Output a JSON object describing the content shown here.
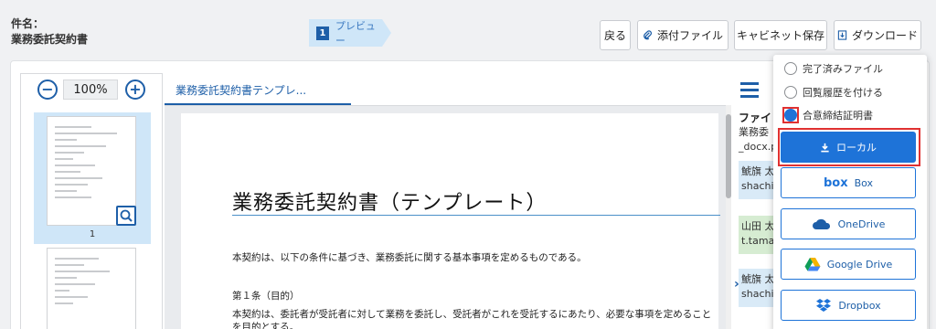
{
  "header": {
    "subject_label": "件名：",
    "subject_value": "業務委託契約書",
    "step_number": "1",
    "step_label": "プレビュー",
    "buttons": {
      "back": "戻る",
      "attach": "添付ファイル",
      "cabinet": "キャビネット保存",
      "download": "ダウンロード"
    }
  },
  "thumbnails": {
    "zoom_value": "100%",
    "zoom_out_icon": "minus-circle-icon",
    "zoom_in_icon": "plus-circle-icon",
    "page_number": "1"
  },
  "document": {
    "tab_label": "業務委託契約書テンプレ...",
    "title": "業務委託契約書（テンプレート）",
    "lines": [
      "本契約は、以下の条件に基づき、業務委託に関する基本事項を定めるものである。",
      "第１条（目的）",
      "本契約は、委託者が受託者に対して業務を委託し、受託者がこれを受託するにあたり、必要な事項を定めること",
      "を目的とする。"
    ]
  },
  "info_panel": {
    "file_label": "ファイ",
    "file_lines": [
      "業務委",
      "_docx.p"
    ],
    "signers": [
      {
        "line1": "鯱旗 太",
        "line2": "shachi",
        "color": "#d9eaf7"
      },
      {
        "line1": "山田 太",
        "line2": "t.tamac",
        "color": "#d6ecd2"
      },
      {
        "line1": "鯱旗 太",
        "line2": "shachi",
        "color": "#d9eaf7"
      }
    ]
  },
  "download_menu": {
    "options": [
      "完了済みファイル",
      "回覧履歴を付ける",
      "合意締結証明書"
    ],
    "selected_option": "合意締結証明書",
    "destinations": {
      "local": "ローカル",
      "box": "Box",
      "onedrive": "OneDrive",
      "google_drive": "Google Drive",
      "dropbox": "Dropbox"
    },
    "box_logo_text": "box"
  },
  "colors": {
    "primary": "#1e73d8",
    "navy": "#1e5fa8",
    "highlight": "#e03131"
  }
}
